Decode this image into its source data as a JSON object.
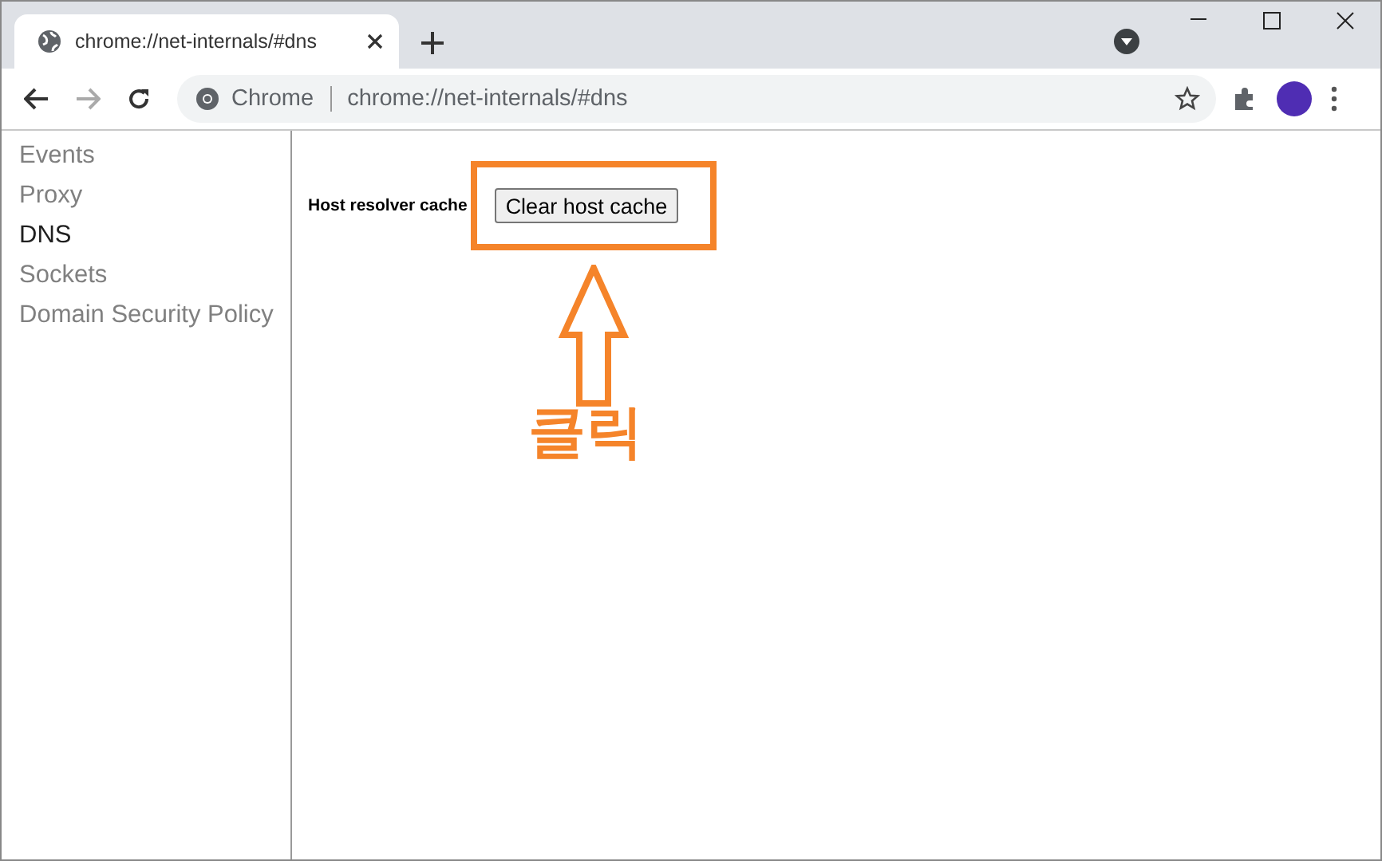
{
  "tab": {
    "title": "chrome://net-internals/#dns"
  },
  "address_bar": {
    "site_chip": "Chrome",
    "url": "chrome://net-internals/#dns"
  },
  "sidebar": {
    "items": [
      {
        "label": "Events",
        "selected": false
      },
      {
        "label": "Proxy",
        "selected": false
      },
      {
        "label": "DNS",
        "selected": true
      },
      {
        "label": "Sockets",
        "selected": false
      },
      {
        "label": "Domain Security Policy",
        "selected": false
      }
    ]
  },
  "content": {
    "label": "Host resolver cache",
    "button": "Clear host cache"
  },
  "annotation": {
    "text": "클릭"
  }
}
